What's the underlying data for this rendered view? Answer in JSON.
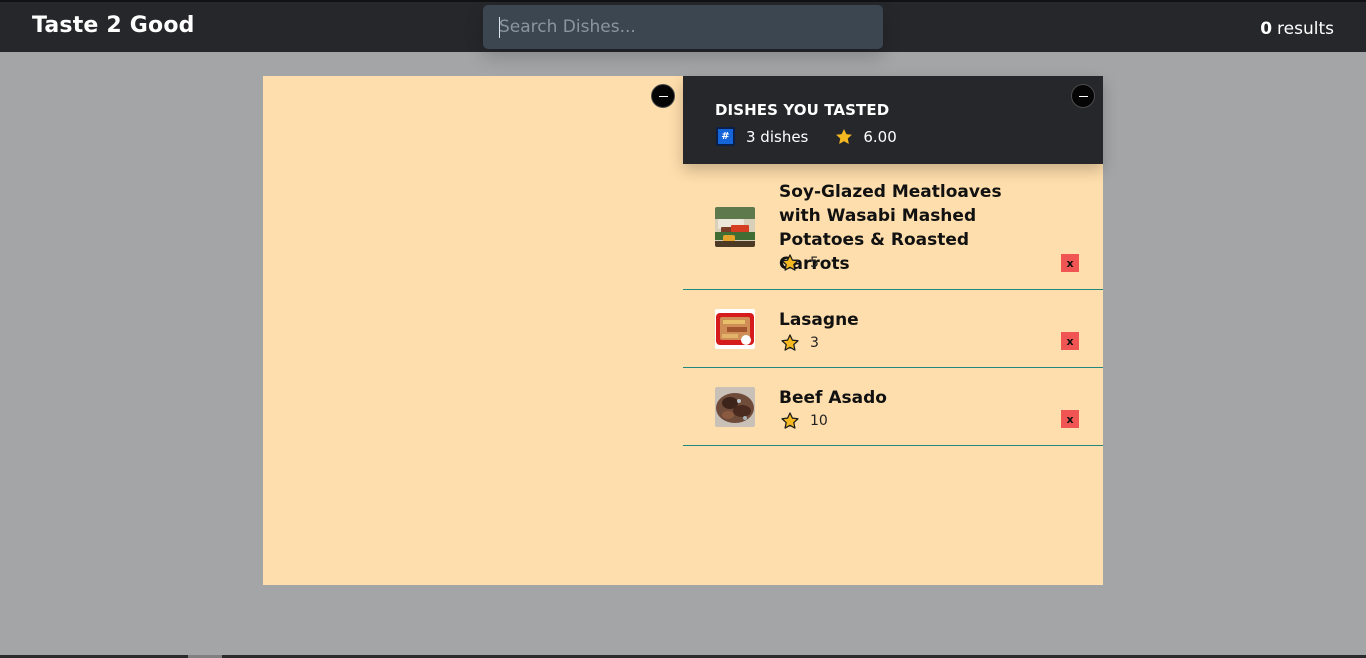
{
  "header": {
    "brand": "Taste 2 Good",
    "search": {
      "placeholder": "Search Dishes...",
      "value": ""
    },
    "results": {
      "count": "0",
      "label": "results"
    }
  },
  "tasted": {
    "title": "DISHES YOU TASTED",
    "hash_icon_label": "#",
    "dish_count_label": "3 dishes",
    "average_rating": "6.00",
    "items": [
      {
        "name": "Soy-Glazed Meatloaves with Wasabi Mashed Potatoes & Roasted Carrots",
        "rating": "5",
        "remove_label": "x",
        "thumb_icon": "meatloaf-thumbnail"
      },
      {
        "name": "Lasagne",
        "rating": "3",
        "remove_label": "x",
        "thumb_icon": "lasagne-thumbnail"
      },
      {
        "name": "Beef Asado",
        "rating": "10",
        "remove_label": "x",
        "thumb_icon": "beef-asado-thumbnail"
      }
    ]
  },
  "icons": {
    "collapse": "minus-circle-icon",
    "count": "hash-icon",
    "average": "gold-star-icon",
    "rating": "star-outline-icon"
  },
  "colors": {
    "page_background": "#a4a5a7",
    "navbar": "#26272b",
    "panel": "#fedeac",
    "search_background": "#3b4650",
    "row_divider": "#22887e",
    "remove_button": "#f05553",
    "star": "#f6b820",
    "hash_icon": "#1564d8"
  }
}
